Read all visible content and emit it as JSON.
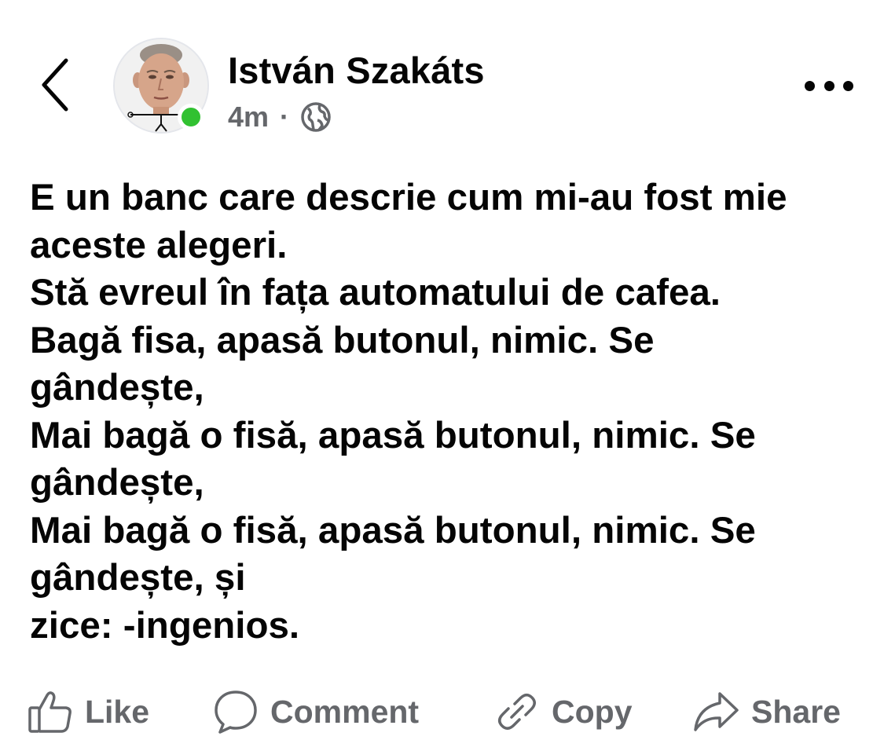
{
  "header": {
    "author_name": "István Szakáts",
    "timestamp": "4m",
    "separator": "·",
    "privacy_icon": "globe-icon",
    "online_status_color": "#31c131",
    "back_icon": "chevron-left-icon",
    "more_icon": "more-horizontal-icon"
  },
  "post": {
    "lines": [
      "E un banc care descrie cum mi-au fost mie",
      "aceste alegeri.",
      "Stă evreul în fața automatului de cafea.",
      "Bagă fisa, apasă butonul, nimic. Se",
      "gândește,",
      "Mai bagă o fisă, apasă butonul, nimic. Se",
      "gândește,",
      "Mai bagă o fisă, apasă butonul, nimic. Se",
      "gândește, și",
      "zice: -ingenios."
    ]
  },
  "actions": {
    "like_label": "Like",
    "comment_label": "Comment",
    "copy_label": "Copy",
    "share_label": "Share",
    "icon_color": "#65676b"
  }
}
